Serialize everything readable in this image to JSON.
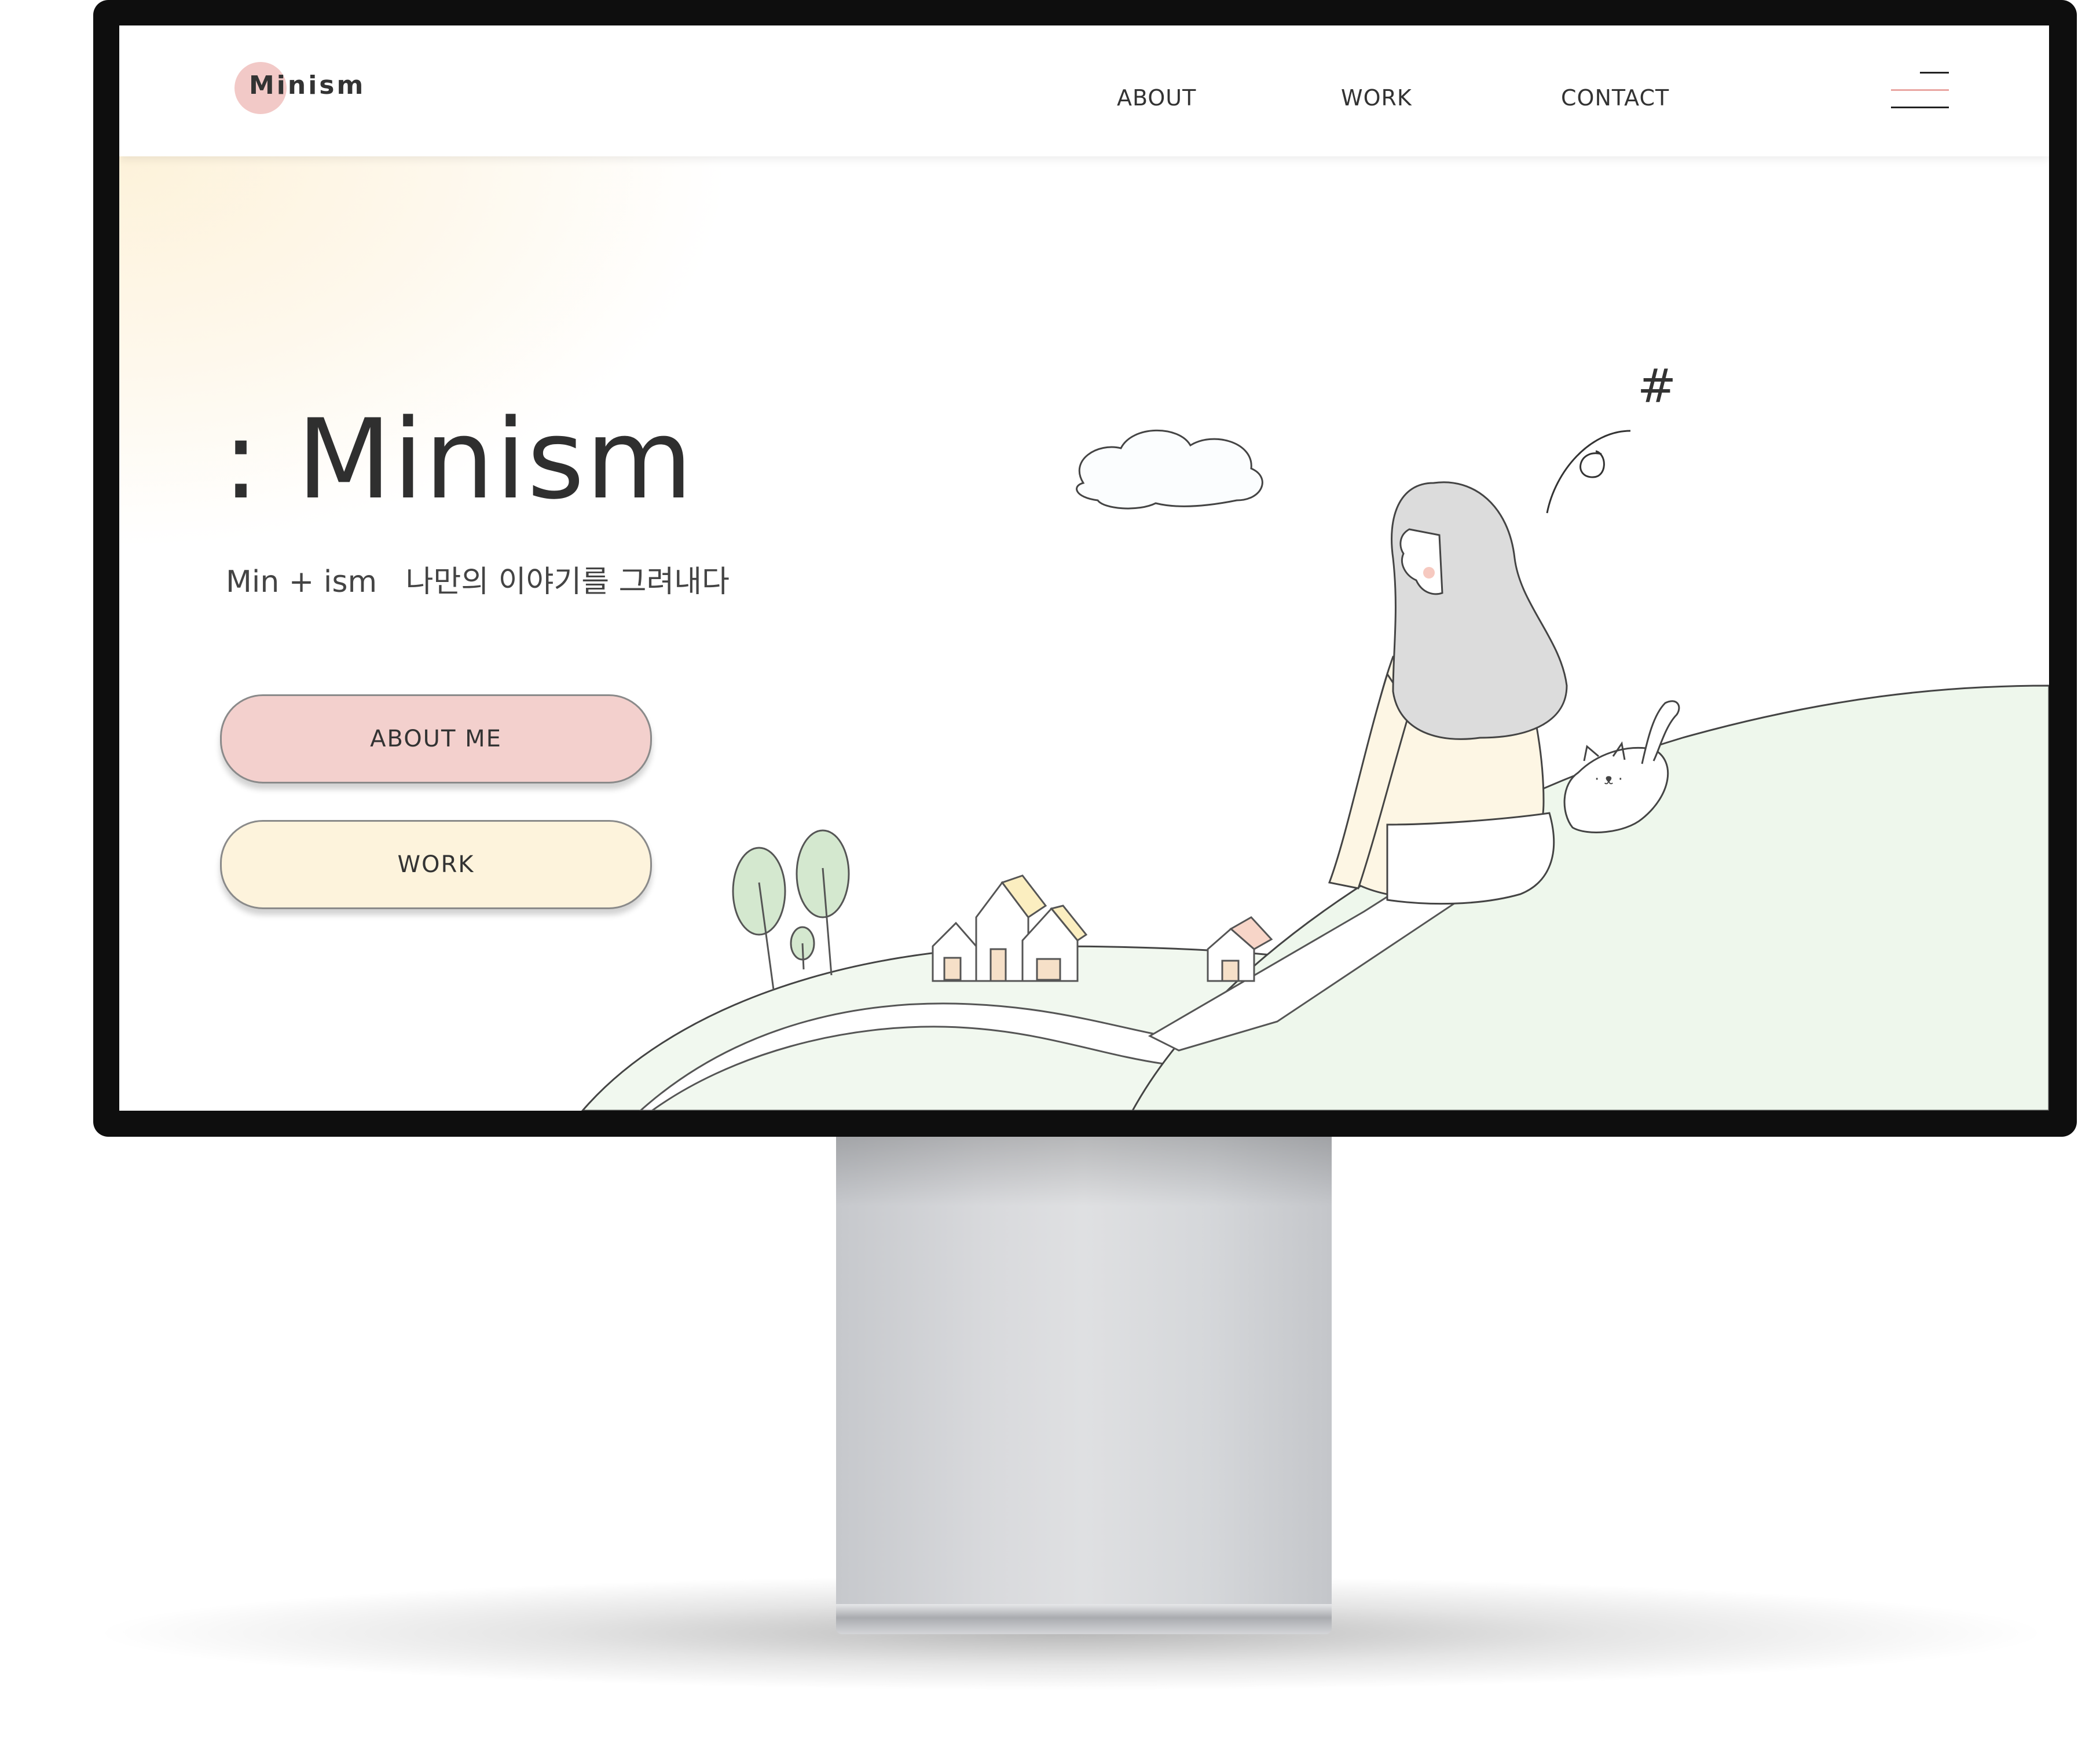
{
  "header": {
    "logo": "Minism",
    "nav": [
      "ABOUT",
      "WORK",
      "CONTACT"
    ]
  },
  "hero": {
    "title": ": Minism",
    "subtitle": "Min + ism   나만의 이야기를 그려내다",
    "buttons": [
      "ABOUT ME",
      "WORK"
    ],
    "illustration_symbol": "#"
  },
  "colors": {
    "accent_pink": "#f3d0cd",
    "accent_cream": "#fdf3dc",
    "hill_green": "#eef7ec",
    "text_dark": "#333333"
  }
}
